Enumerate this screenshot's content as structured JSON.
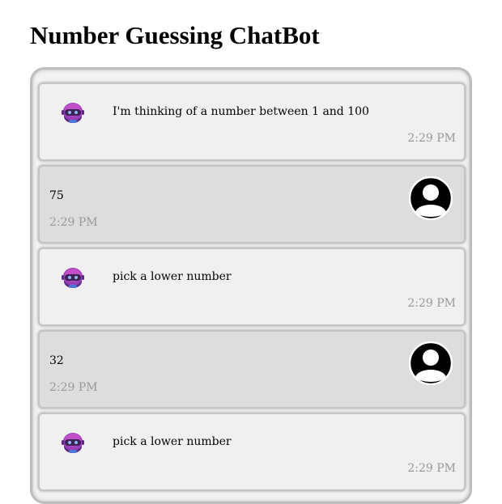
{
  "page": {
    "title": "Number Guessing ChatBot"
  },
  "messages": [
    {
      "sender": "bot",
      "text": "I'm thinking of a number between 1 and 100",
      "time": "2:29 PM",
      "avatar_icon": "robot-icon"
    },
    {
      "sender": "user",
      "text": "75",
      "time": "2:29 PM",
      "avatar_icon": "user-avatar-icon"
    },
    {
      "sender": "bot",
      "text": "pick a lower number",
      "time": "2:29 PM",
      "avatar_icon": "robot-icon"
    },
    {
      "sender": "user",
      "text": "32",
      "time": "2:29 PM",
      "avatar_icon": "user-avatar-icon"
    },
    {
      "sender": "bot",
      "text": "pick a lower number",
      "time": "2:29 PM",
      "avatar_icon": "robot-icon"
    }
  ],
  "colors": {
    "bot_bubble": "#f0f0f0",
    "user_bubble": "#dddddd",
    "timestamp": "#999999",
    "robot_accent": "#8e3aa8"
  }
}
